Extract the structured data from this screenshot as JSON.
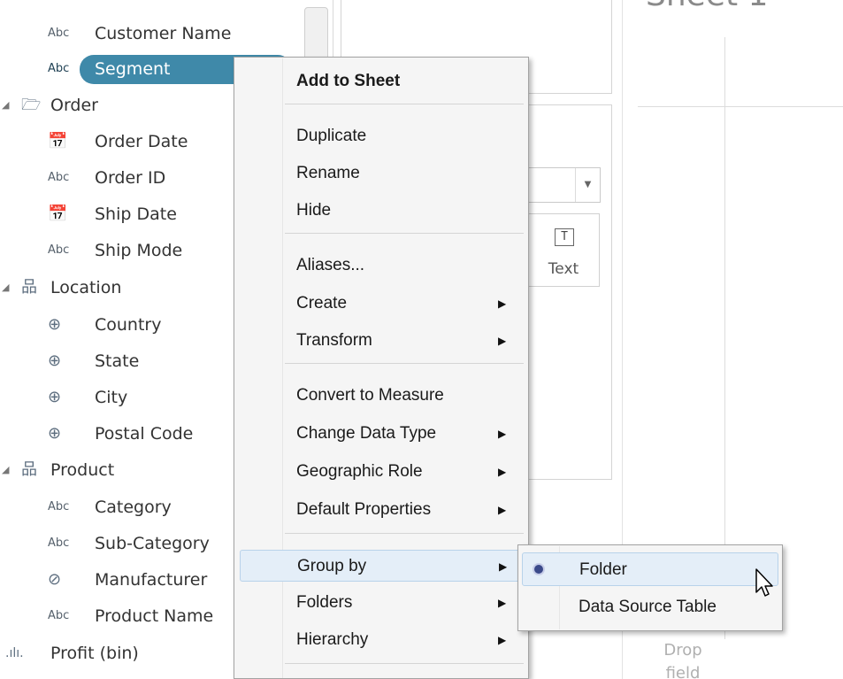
{
  "data_pane": {
    "fields": [
      {
        "type_icon": "Abc",
        "icon_name": "string-type-icon",
        "label": "Customer Name"
      },
      {
        "type_icon": "Abc",
        "icon_name": "string-type-icon",
        "label": "Segment",
        "selected": true
      },
      {
        "type_icon": "Abc",
        "icon_name": "string-type-icon",
        "label": "Order ID"
      },
      {
        "type_icon": "Abc",
        "icon_name": "string-type-icon",
        "label": "Ship Mode"
      },
      {
        "type_icon": "Abc",
        "icon_name": "string-type-icon",
        "label": "Category"
      },
      {
        "type_icon": "Abc",
        "icon_name": "string-type-icon",
        "label": "Sub-Category"
      },
      {
        "type_icon": "Abc",
        "icon_name": "string-type-icon",
        "label": "Product Name"
      }
    ],
    "date_fields": [
      "Order Date",
      "Ship Date"
    ],
    "geo_fields": [
      "Country",
      "State",
      "City",
      "Postal Code"
    ],
    "folders": [
      "Order",
      "Location",
      "Product"
    ],
    "other_fields": {
      "manufacturer": "Manufacturer",
      "profit_bin": "Profit (bin)"
    }
  },
  "marks_card": {
    "text_button_label": "Text",
    "text_button_icon": "T"
  },
  "sheet": {
    "title": "Sheet 1",
    "drop_text": "Drop field"
  },
  "context_menu": {
    "items": [
      {
        "label": "Add to Sheet",
        "bold": true
      },
      {
        "label": "Duplicate"
      },
      {
        "label": "Rename"
      },
      {
        "label": "Hide"
      },
      {
        "label": "Aliases..."
      },
      {
        "label": "Create",
        "submenu": true
      },
      {
        "label": "Transform",
        "submenu": true
      },
      {
        "label": "Convert to Measure"
      },
      {
        "label": "Change Data Type",
        "submenu": true
      },
      {
        "label": "Geographic Role",
        "submenu": true
      },
      {
        "label": "Default Properties",
        "submenu": true
      },
      {
        "label": "Group by",
        "submenu": true,
        "hover": true
      },
      {
        "label": "Folders",
        "submenu": true
      },
      {
        "label": "Hierarchy",
        "submenu": true
      }
    ]
  },
  "group_by_submenu": {
    "items": [
      {
        "label": "Folder",
        "checked": true
      },
      {
        "label": "Data Source Table"
      }
    ]
  },
  "colors": {
    "selection_pill": "#3f89a9",
    "menu_background": "#f5f5f5",
    "hover_background": "#e4eef8",
    "radio_dot": "#3b4a8a"
  }
}
